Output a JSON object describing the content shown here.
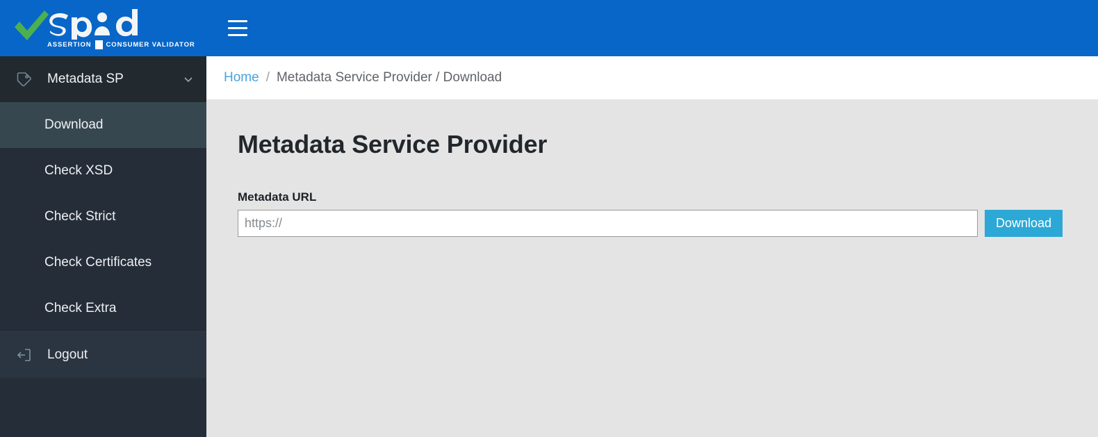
{
  "header": {
    "logo": {
      "wordmark": "spid",
      "tagline_left": "ASSERTION",
      "tagline_right": "CONSUMER VALIDATOR",
      "check_color": "#4cb050",
      "bar_color": "#0766c8"
    },
    "menu_toggle_label": "Toggle navigation",
    "background_color": "#0766c8"
  },
  "sidebar": {
    "group": {
      "label": "Metadata SP",
      "icon": "tag-icon",
      "chevron": "chevron-down-icon",
      "expanded": true
    },
    "items": [
      {
        "label": "Download",
        "active": true
      },
      {
        "label": "Check XSD",
        "active": false
      },
      {
        "label": "Check Strict",
        "active": false
      },
      {
        "label": "Check Certificates",
        "active": false
      },
      {
        "label": "Check Extra",
        "active": false
      }
    ],
    "logout": {
      "label": "Logout",
      "icon": "sign-out-icon"
    },
    "background_color": "#252d38",
    "active_color": "#37474f"
  },
  "breadcrumb": {
    "home": "Home",
    "separator": "/",
    "trail": "Metadata Service Provider / Download",
    "home_color": "#4aa3df"
  },
  "main": {
    "title": "Metadata Service Provider",
    "form": {
      "label": "Metadata URL",
      "input_value": "",
      "input_placeholder": "https://",
      "submit_label": "Download",
      "submit_color": "#2ca8d6"
    },
    "background_color": "#e4e4e5"
  }
}
